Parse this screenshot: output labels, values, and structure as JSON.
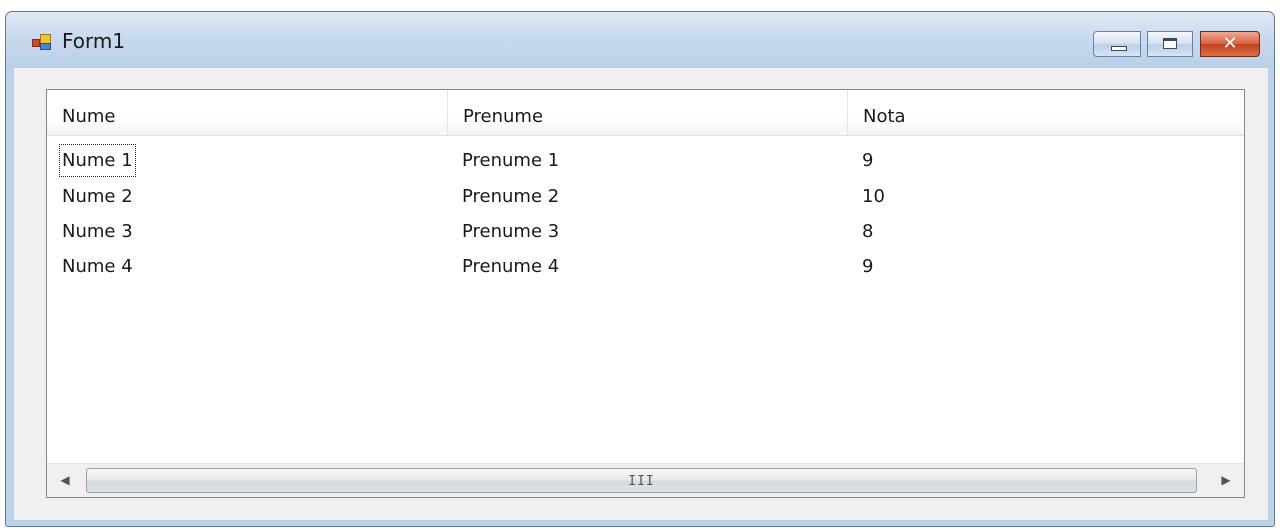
{
  "window": {
    "title": "Form1",
    "icon": "app-form-icon",
    "controls": {
      "minimize": "minimize-icon",
      "maximize": "maximize-icon",
      "close": "close-icon",
      "close_glyph": "✕"
    }
  },
  "listview": {
    "columns": [
      "Nume",
      "Prenume",
      "Nota"
    ],
    "rows": [
      [
        "Nume 1",
        "Prenume 1",
        "9"
      ],
      [
        "Nume 2",
        "Prenume 2",
        "10"
      ],
      [
        "Nume 3",
        "Prenume 3",
        "8"
      ],
      [
        "Nume 4",
        "Prenume 4",
        "9"
      ]
    ],
    "focused_row": 0,
    "scrollbar": {
      "left_arrow": "◀",
      "right_arrow": "▶",
      "grip": "III"
    }
  }
}
